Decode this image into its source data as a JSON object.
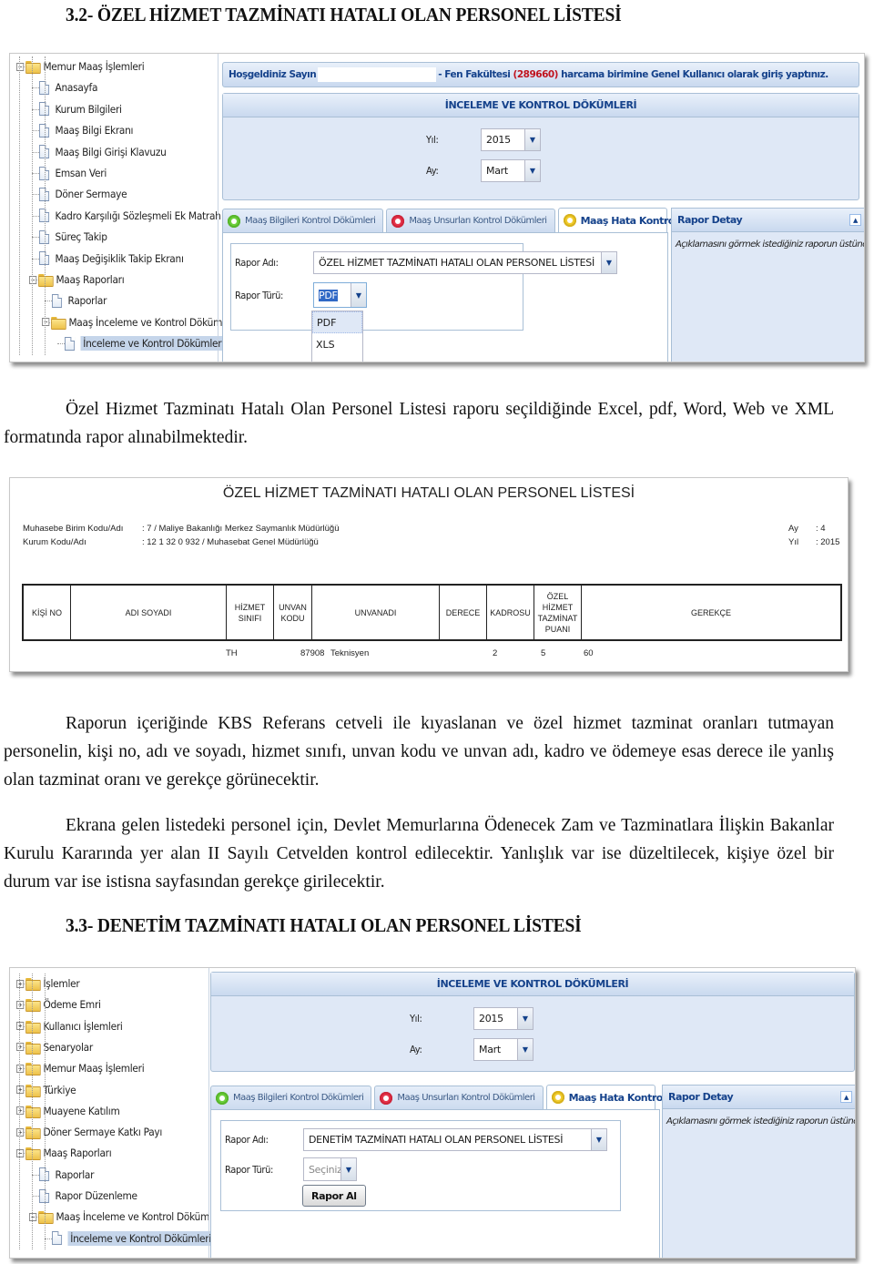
{
  "doc": {
    "heading_1": "3.2- ÖZEL HİZMET TAZMİNATI HATALI OLAN PERSONEL LİSTESİ",
    "para_1": "Özel Hizmet Tazminatı Hatalı Olan Personel Listesi raporu seçildiğinde Excel, pdf, Word, Web ve XML formatında rapor alınabilmektedir.",
    "para_2": "Raporun içeriğinde KBS Referans cetveli ile kıyaslanan ve özel hizmet tazminat oranları tutmayan personelin, kişi no, adı ve soyadı, hizmet sınıfı, unvan kodu ve unvan adı, kadro ve ödemeye esas derece ile yanlış olan tazminat oranı ve gerekçe görünecektir.",
    "para_3": "Ekrana gelen listedeki personel için, Devlet Memurlarına Ödenecek Zam ve Tazminatlara İlişkin Bakanlar Kurulu Kararında yer alan II Sayılı Cetvelden kontrol edilecektir. Yanlışlık var ise düzeltilecek, kişiye özel bir durum var ise istisna sayfasından gerekçe girilecektir.",
    "heading_2": "3.3- DENETİM TAZMİNATI HATALI OLAN PERSONEL LİSTESİ"
  },
  "screen1": {
    "tree": [
      {
        "label": "Memur Maaş İşlemleri",
        "type": "folder",
        "expander": "−",
        "level": 0
      },
      {
        "label": "Anasayfa",
        "type": "page",
        "level": 1
      },
      {
        "label": "Kurum Bilgileri",
        "type": "page",
        "level": 1
      },
      {
        "label": "Maaş Bilgi Ekranı",
        "type": "page",
        "level": 1
      },
      {
        "label": "Maaş Bilgi Girişi Klavuzu",
        "type": "page",
        "level": 1
      },
      {
        "label": "Emsan Veri",
        "type": "page",
        "level": 1
      },
      {
        "label": "Döner Sermaye",
        "type": "page",
        "level": 1
      },
      {
        "label": "Kadro Karşılığı Sözleşmeli Ek Matrah",
        "type": "page",
        "level": 1
      },
      {
        "label": "Süreç Takip",
        "type": "page",
        "level": 1
      },
      {
        "label": "Maaş Değişiklik Takip Ekranı",
        "type": "page",
        "level": 1
      },
      {
        "label": "Maaş Raporları",
        "type": "folder",
        "expander": "−",
        "level": 1
      },
      {
        "label": "Raporlar",
        "type": "page",
        "level": 2
      },
      {
        "label": "Maaş İnceleme ve Kontrol Dökümleri",
        "type": "folder",
        "expander": "−",
        "level": 2
      },
      {
        "label": "İnceleme ve Kontrol Dökümleri",
        "type": "page",
        "level": 3,
        "selected": true
      }
    ],
    "welcome": {
      "prefix": "Hoşgeldiniz Sayın",
      "unit": "- Fen Fakültesi",
      "code": "(289660)",
      "suffix": "harcama birimine Genel Kullanıcı olarak giriş yaptınız."
    },
    "panel_title": "İNCELEME VE KONTROL DÖKÜMLERİ",
    "yil_label": "Yıl:",
    "yil_value": "2015",
    "ay_label": "Ay:",
    "ay_value": "Mart",
    "tabs": [
      {
        "label": "Maaş Bilgileri Kontrol Dökümleri",
        "icon": "gear-green"
      },
      {
        "label": "Maaş Unsurları Kontrol Dökümleri",
        "icon": "gear-red"
      },
      {
        "label": "Maaş Hata Kontrol Dökümleri",
        "icon": "gear-yellow",
        "active": true
      }
    ],
    "rapor_adi_label": "Rapor Adı:",
    "rapor_adi_value": "ÖZEL HİZMET TAZMİNATI HATALI OLAN PERSONEL LİSTESİ",
    "rapor_turu_label": "Rapor Türü:",
    "rapor_turu_value": "PDF",
    "rapor_turu_options": [
      "PDF",
      "XLS"
    ],
    "side_title": "Rapor Detay",
    "side_text": "Açıklamasını görmek istediğiniz raporun üstüne geliniz."
  },
  "report": {
    "title": "ÖZEL HİZMET TAZMİNATI HATALI OLAN PERSONEL LİSTESİ",
    "muhasebe_label": "Muhasebe Birim Kodu/Adı",
    "muhasebe_value": ": 7      / Maliye Bakanlığı Merkez Saymanlık Müdürlüğü",
    "kurum_label": "Kurum Kodu/Adı",
    "kurum_value": ": 12  1    32  0    932  / Muhasebat Genel Müdürlüğü",
    "ay_label": "Ay",
    "ay_value": ": 4",
    "yil_label": "Yıl",
    "yil_value": ": 2015",
    "columns": [
      "KİŞİ NO",
      "ADI  SOYADI",
      "HİZMET SINIFI",
      "UNVAN KODU",
      "UNVANADI",
      "DERECE",
      "KADROSU",
      "ÖZEL HİZMET TAZMİNAT PUANI",
      "GEREKÇE"
    ],
    "rows": [
      {
        "kisi_no": "",
        "adi_soyadi": "",
        "hizmet_sinifi": "TH",
        "unvan_kodu": "87908",
        "unvan_adi": "Teknisyen",
        "derece": "2",
        "kadrosu": "5",
        "puan": "60",
        "gerekce": ""
      }
    ]
  },
  "screen2": {
    "tree": [
      {
        "label": "İşlemler",
        "type": "folder",
        "expander": "+",
        "level": 0
      },
      {
        "label": "Ödeme Emri",
        "type": "folder",
        "expander": "+",
        "level": 0
      },
      {
        "label": "Kullanıcı İşlemleri",
        "type": "folder",
        "expander": "+",
        "level": 0
      },
      {
        "label": "Senaryolar",
        "type": "folder",
        "expander": "+",
        "level": 0
      },
      {
        "label": "Memur Maaş İşlemleri",
        "type": "folder",
        "expander": "+",
        "level": 0
      },
      {
        "label": "Türkiye",
        "type": "folder",
        "expander": "+",
        "level": 0
      },
      {
        "label": "Muayene Katılım",
        "type": "folder",
        "expander": "+",
        "level": 0
      },
      {
        "label": "Döner Sermaye Katkı Payı",
        "type": "folder",
        "expander": "+",
        "level": 0
      },
      {
        "label": "Maaş Raporları",
        "type": "folder",
        "expander": "−",
        "level": 0
      },
      {
        "label": "Raporlar",
        "type": "page",
        "level": 1
      },
      {
        "label": "Rapor Düzenleme",
        "type": "page",
        "level": 1
      },
      {
        "label": "Maaş İnceleme ve Kontrol Dökümleri",
        "type": "folder",
        "expander": "−",
        "level": 1
      },
      {
        "label": "İnceleme ve Kontrol Dökümleri",
        "type": "page",
        "level": 2,
        "selected": true
      }
    ],
    "panel_title": "İNCELEME VE KONTROL DÖKÜMLERİ",
    "yil_label": "Yıl:",
    "yil_value": "2015",
    "ay_label": "Ay:",
    "ay_value": "Mart",
    "tabs": [
      {
        "label": "Maaş Bilgileri Kontrol Dökümleri",
        "icon": "gear-green"
      },
      {
        "label": "Maaş Unsurları Kontrol Dökümleri",
        "icon": "gear-red"
      },
      {
        "label": "Maaş Hata Kontrol Dökümleri",
        "icon": "gear-yellow",
        "active": true
      }
    ],
    "rapor_adi_label": "Rapor Adı:",
    "rapor_adi_value": "DENETİM TAZMİNATI HATALI OLAN PERSONEL LİSTESİ",
    "rapor_turu_label": "Rapor Türü:",
    "rapor_turu_placeholder": "Seçiniz",
    "rapor_al_button": "Rapor Al",
    "side_title": "Rapor Detay",
    "side_text": "Açıklamasını görmek istediğiniz raporun üstüne geliniz."
  }
}
